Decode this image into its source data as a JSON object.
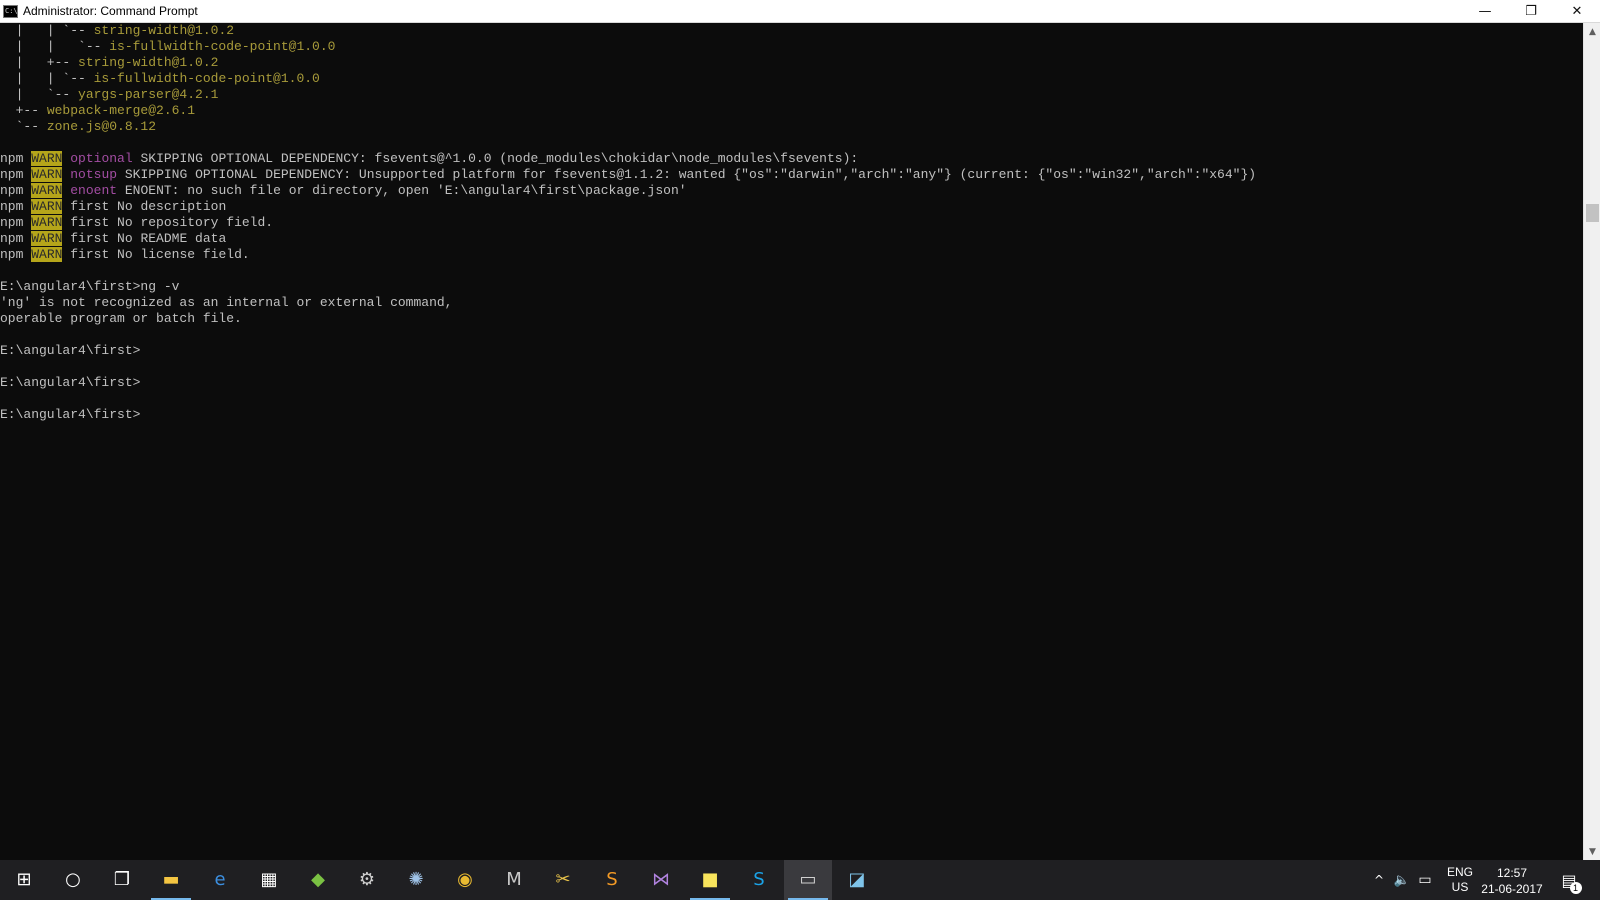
{
  "window": {
    "title": "Administrator: Command Prompt",
    "icon_text": "C:\\",
    "minimize_glyph": "—",
    "maximize_glyph": "❐",
    "close_glyph": "✕"
  },
  "console": {
    "tree_lines": [
      {
        "prefix": "  |   | `-- ",
        "name": "string-width@1.0.2"
      },
      {
        "prefix": "  |   |   `-- ",
        "name": "is-fullwidth-code-point@1.0.0"
      },
      {
        "prefix": "  |   +-- ",
        "name": "string-width@1.0.2"
      },
      {
        "prefix": "  |   | `-- ",
        "name": "is-fullwidth-code-point@1.0.0"
      },
      {
        "prefix": "  |   `-- ",
        "name": "yargs-parser@4.2.1"
      },
      {
        "prefix": "  +-- ",
        "name": "webpack-merge@2.6.1"
      },
      {
        "prefix": "  `-- ",
        "name": "zone.js@0.8.12"
      }
    ],
    "warn_lines": [
      {
        "npm": "npm",
        "warn": "WARN",
        "kind": "optional",
        "purple": true,
        "message": " SKIPPING OPTIONAL DEPENDENCY: fsevents@^1.0.0 (node_modules\\chokidar\\node_modules\\fsevents):"
      },
      {
        "npm": "npm",
        "warn": "WARN",
        "kind": "notsup",
        "purple": true,
        "message": " SKIPPING OPTIONAL DEPENDENCY: Unsupported platform for fsevents@1.1.2: wanted {\"os\":\"darwin\",\"arch\":\"any\"} (current: {\"os\":\"win32\",\"arch\":\"x64\"})"
      },
      {
        "npm": "npm",
        "warn": "WARN",
        "kind": "enoent",
        "purple": true,
        "message": " ENOENT: no such file or directory, open 'E:\\angular4\\first\\package.json'"
      },
      {
        "npm": "npm",
        "warn": "WARN",
        "kind": "",
        "purple": false,
        "message": " first No description"
      },
      {
        "npm": "npm",
        "warn": "WARN",
        "kind": "",
        "purple": false,
        "message": " first No repository field."
      },
      {
        "npm": "npm",
        "warn": "WARN",
        "kind": "",
        "purple": false,
        "message": " first No README data"
      },
      {
        "npm": "npm",
        "warn": "WARN",
        "kind": "",
        "purple": false,
        "message": " first No license field."
      }
    ],
    "command_line": "E:\\angular4\\first>ng -v",
    "error_line_1": "'ng' is not recognized as an internal or external command,",
    "error_line_2": "operable program or batch file.",
    "prompt_1": "E:\\angular4\\first>",
    "prompt_2": "E:\\angular4\\first>",
    "prompt_3": "E:\\angular4\\first>"
  },
  "taskbar": {
    "items": [
      {
        "name": "start-button",
        "icon": "windows-logo-icon",
        "glyph": "⊞",
        "color": "#ffffff"
      },
      {
        "name": "search-button",
        "icon": "cortana-circle-icon",
        "glyph": "○",
        "color": "#ffffff"
      },
      {
        "name": "task-view-button",
        "icon": "task-view-icon",
        "glyph": "❐",
        "color": "#ffffff"
      },
      {
        "name": "file-explorer-button",
        "icon": "folder-icon",
        "glyph": "▬",
        "color": "#f4c542"
      },
      {
        "name": "edge-button",
        "icon": "edge-icon",
        "glyph": "e",
        "color": "#3c8fe0"
      },
      {
        "name": "store-button",
        "icon": "store-bag-icon",
        "glyph": "▦",
        "color": "#ffffff"
      },
      {
        "name": "app-green-button",
        "icon": "green-diamond-icon",
        "glyph": "◆",
        "color": "#7ac143"
      },
      {
        "name": "app-tool-button",
        "icon": "tool-icon",
        "glyph": "⚙",
        "color": "#d0d0d0"
      },
      {
        "name": "app-globe-button",
        "icon": "globe-icon",
        "glyph": "✺",
        "color": "#9fc3e8"
      },
      {
        "name": "chrome-button",
        "icon": "chrome-icon",
        "glyph": "◉",
        "color": "#e8b931"
      },
      {
        "name": "app-m-button",
        "icon": "m-icon",
        "glyph": "M",
        "color": "#c8c8c8"
      },
      {
        "name": "app-tools-button",
        "icon": "tools-icon",
        "glyph": "✂",
        "color": "#e6c14a"
      },
      {
        "name": "sublime-button",
        "icon": "sublime-icon",
        "glyph": "S",
        "color": "#f49a25"
      },
      {
        "name": "visual-studio-button",
        "icon": "visual-studio-icon",
        "glyph": "⋈",
        "color": "#b183e0"
      },
      {
        "name": "sticky-notes-button",
        "icon": "sticky-note-icon",
        "glyph": "■",
        "color": "#f8e45c"
      },
      {
        "name": "skype-button",
        "icon": "skype-icon",
        "glyph": "S",
        "color": "#1aa3e8"
      },
      {
        "name": "command-prompt-button",
        "icon": "command-prompt-icon",
        "glyph": "▭",
        "color": "#d0d0d0"
      },
      {
        "name": "app-notepad-button",
        "icon": "notepad-icon",
        "glyph": "◪",
        "color": "#7fc4ea"
      }
    ],
    "tray": {
      "chevron": "^",
      "volume": "🔈",
      "network": "▭",
      "lang_line_1": "ENG",
      "lang_line_2": "US",
      "time": "12:57",
      "date": "21-06-2017",
      "notification_glyph": "▤",
      "notification_count": "1"
    }
  },
  "colors": {
    "console_bg": "#0c0c0c",
    "console_text": "#c0c0c0",
    "package_text": "#a89b3a",
    "warn_bg": "#b5a51a",
    "warn_kind": "#a34da3",
    "taskbar_bg": "#1f1f22",
    "running_indicator": "#76b9ed"
  }
}
